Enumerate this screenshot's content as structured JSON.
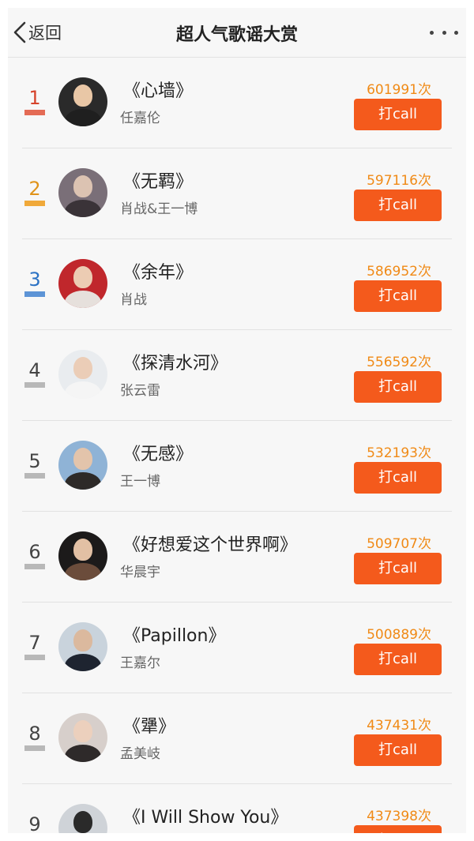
{
  "header": {
    "back_label": "返回",
    "title": "超人气歌谣大赏",
    "more_icon": "more-dots-icon"
  },
  "colors": {
    "rank_gold_top": "#e84b2c",
    "count_orange": "#f08a16",
    "button_orange": "#f45a1c"
  },
  "songs": [
    {
      "rank": "1",
      "title": "《心墙》",
      "artist": "任嘉伦",
      "count": "601991次",
      "button_label": "打call",
      "rank_color": "#d6432b",
      "bar_color": "#e46b55",
      "avatar_bg": "#2a2a2a",
      "avatar_head": "#e9c7a6",
      "avatar_body": "#1f1f1f"
    },
    {
      "rank": "2",
      "title": "《无羁》",
      "artist": "肖战&王一博",
      "count": "597116次",
      "button_label": "打call",
      "rank_color": "#e0931a",
      "bar_color": "#f0a93a",
      "avatar_bg": "#7a6f78",
      "avatar_head": "#dcc3b2",
      "avatar_body": "#3a3338"
    },
    {
      "rank": "3",
      "title": "《余年》",
      "artist": "肖战",
      "count": "586952次",
      "button_label": "打call",
      "rank_color": "#2b72c4",
      "bar_color": "#5d94d6",
      "avatar_bg": "#c0272c",
      "avatar_head": "#ecccb3",
      "avatar_body": "#e6e0dc"
    },
    {
      "rank": "4",
      "title": "《探清水河》",
      "artist": "张云雷",
      "count": "556592次",
      "button_label": "打call",
      "rank_color": "#444444",
      "bar_color": "#b8b8b8",
      "avatar_bg": "#e9ecef",
      "avatar_head": "#ebcdb7",
      "avatar_body": "#f5f5f5"
    },
    {
      "rank": "5",
      "title": "《无感》",
      "artist": "王一博",
      "count": "532193次",
      "button_label": "打call",
      "rank_color": "#444444",
      "bar_color": "#b8b8b8",
      "avatar_bg": "#8fb3d6",
      "avatar_head": "#e3c4ab",
      "avatar_body": "#2d2a28"
    },
    {
      "rank": "6",
      "title": "《好想爱这个世界啊》",
      "artist": "华晨宇",
      "count": "509707次",
      "button_label": "打call",
      "rank_color": "#444444",
      "bar_color": "#b8b8b8",
      "avatar_bg": "#1c1a1a",
      "avatar_head": "#e2c0a4",
      "avatar_body": "#6b4c3b"
    },
    {
      "rank": "7",
      "title": "《Papillon》",
      "artist": "王嘉尔",
      "count": "500889次",
      "button_label": "打call",
      "rank_color": "#444444",
      "bar_color": "#b8b8b8",
      "avatar_bg": "#c9d3dc",
      "avatar_head": "#dbb99e",
      "avatar_body": "#1e2430"
    },
    {
      "rank": "8",
      "title": "《犟》",
      "artist": "孟美岐",
      "count": "437431次",
      "button_label": "打call",
      "rank_color": "#444444",
      "bar_color": "#b8b8b8",
      "avatar_bg": "#d7cfcb",
      "avatar_head": "#ecd0bd",
      "avatar_body": "#2e2a2a"
    },
    {
      "rank": "9",
      "title": "《I Will Show You》",
      "artist": "",
      "count": "437398次",
      "button_label": "打call",
      "rank_color": "#444444",
      "bar_color": "#b8b8b8",
      "avatar_bg": "#cfd3d8",
      "avatar_head": "#2a2a2a",
      "avatar_body": "#3a3a3a"
    }
  ]
}
